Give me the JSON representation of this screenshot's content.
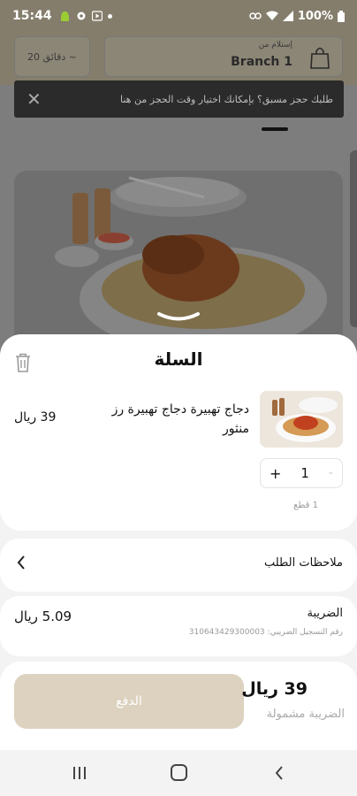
{
  "status_bar": {
    "time": "15:44",
    "battery": "100%"
  },
  "header": {
    "delivery_time": "20 دقائق ~",
    "branch_label": "إستلام من",
    "branch_name": "Branch 1"
  },
  "tooltip": {
    "text": "طلبك حجز مسبق؟ بإمكانك اختيار وقت الحجز من هنا"
  },
  "cart": {
    "title": "السلة",
    "item": {
      "name": "دجاج تهبيرة دجاج تهبيرة رز منثور",
      "price": "39 ريال",
      "quantity": "1",
      "quantity_note": "1 قطع"
    },
    "notes_label": "ملاحظات الطلب",
    "tax_label": "الضريبة",
    "tax_registration": "رقم التسجيل الضريبي: 310643429300003",
    "tax_amount": "5.09 ريال",
    "total": "39 ريال",
    "total_note": "الضريبة مشمولة",
    "pay_button": "الدفع"
  }
}
